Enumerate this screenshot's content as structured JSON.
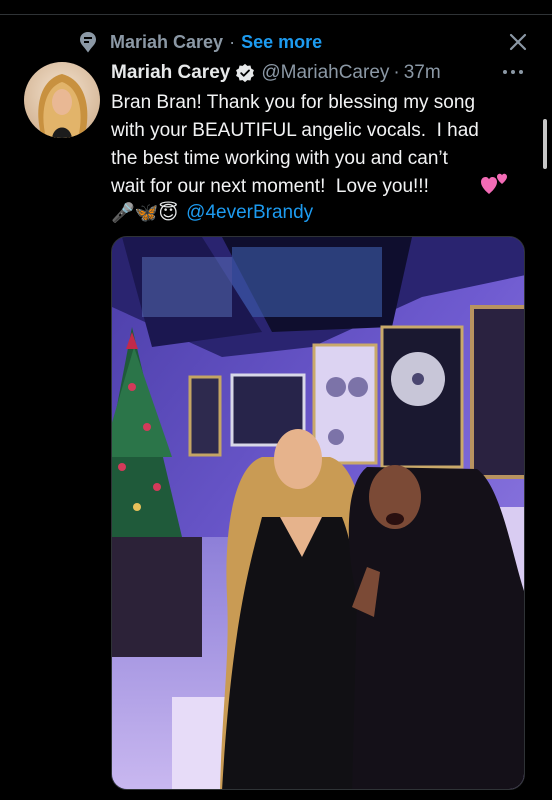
{
  "notice": {
    "name": "Mariah Carey",
    "separator": "·",
    "see_more": "See more",
    "icon": "pin-icon"
  },
  "close_icon": "close-icon",
  "tweet": {
    "display_name": "Mariah Carey",
    "handle": "@MariahCarey",
    "dot": "·",
    "time": "37m",
    "text": "Bran Bran! Thank you for blessing my song\nwith your BEAUTIFUL angelic vocals.  I had\nthe best time working with you and can’t\nwait for our next moment!  Love you!!!",
    "emoji_microphone": "🎤",
    "emoji_butterfly": "🦋",
    "emoji_halo": "😇",
    "mention": "@4everBrandy"
  },
  "colors": {
    "background": "#000000",
    "accent": "#1d9bf0",
    "secondary_text": "#8b98a5",
    "primary_text": "#e7e9ea"
  }
}
